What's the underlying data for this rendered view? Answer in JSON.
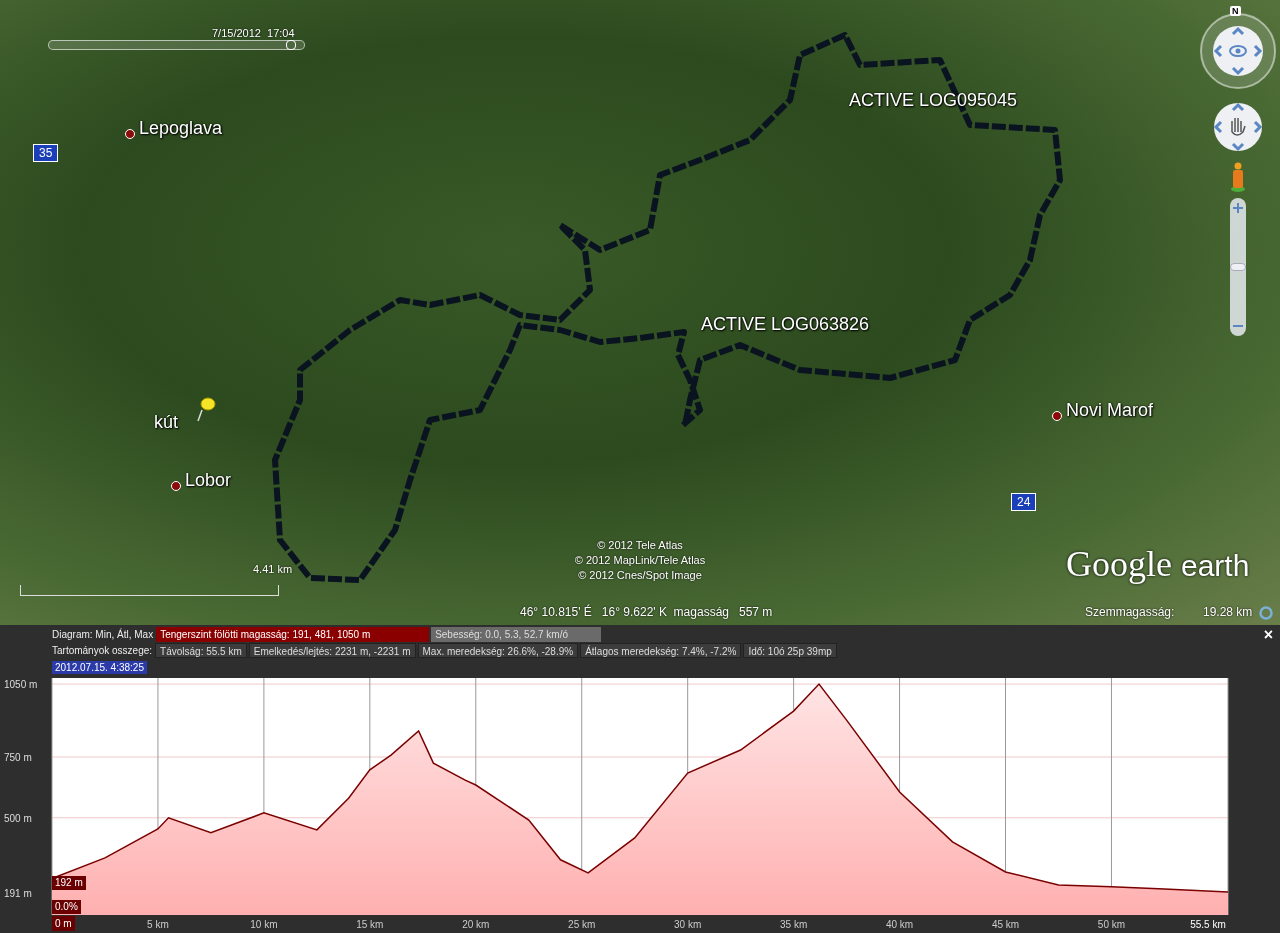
{
  "map": {
    "time_slider": {
      "label": "7/15/2012  17:04",
      "level": 0.96
    },
    "places": [
      {
        "kind": "town",
        "name": "Lepoglava"
      },
      {
        "kind": "town",
        "name": "Lobor"
      },
      {
        "kind": "town",
        "name": "Novi Marof"
      },
      {
        "kind": "pin",
        "name": "kút"
      },
      {
        "kind": "track",
        "name": "ACTIVE LOG095045"
      },
      {
        "kind": "track",
        "name": "ACTIVE LOG063826"
      },
      {
        "kind": "road",
        "name": "35"
      },
      {
        "kind": "road",
        "name": "24"
      }
    ],
    "zoom": {
      "level": 0.5
    },
    "attribution": [
      "© 2012 Tele Atlas",
      "© 2012 MapLink/Tele Atlas",
      "© 2012 Cnes/Spot Image"
    ],
    "scale": "4.41 km",
    "logo": {
      "brand": "Google",
      "product": "earth"
    },
    "status": {
      "coordinates": "46° 10.815' É   16° 9.622' K  magasság   557 m",
      "eye_label": "Szemmagasság:",
      "eye_value": "19.28 km"
    },
    "compass": "N"
  },
  "panel": {
    "diagram": {
      "label": "Diagram: Min, Átl, Max",
      "items": [
        {
          "text": "Tengerszint fölötti magasság: 191, 481, 1050 m",
          "selected": true
        },
        {
          "text": "Sebesség: 0.0, 5.3, 52.7 km/ó",
          "selected": false
        }
      ]
    },
    "totals": {
      "label": "Tartományok osszege:",
      "items": [
        "Távolság: 55.5 km",
        "Emelkedés/lejtés: 2231 m, -2231 m",
        "Max. meredekség: 26.6%, -28.9%",
        "Átlagos meredekség: 7.4%, -7.2%",
        "Idő: 10ó 25p 39mp"
      ]
    },
    "cursor_time": "2012.07.15. 4:38:25",
    "close": "×",
    "markers": {
      "elevation": "192 m",
      "slope": "0.0%"
    },
    "chart_data": {
      "type": "area",
      "x": [
        0,
        2.5,
        5,
        5.5,
        7.5,
        10,
        12.5,
        14,
        15,
        16,
        17.3,
        18,
        19.5,
        20,
        22.5,
        24,
        25.3,
        27.5,
        30,
        32.5,
        35,
        36.2,
        37.5,
        40,
        42.5,
        45,
        47.5,
        50,
        52.5,
        55.5
      ],
      "grid": true,
      "series": [
        {
          "color": "#7a0000",
          "values": [
            250,
            335,
            454,
            500,
            438,
            520,
            450,
            580,
            697,
            758,
            857,
            725,
            655,
            635,
            491,
            327,
            273,
            417,
            684,
            779,
            939,
            1050,
            902,
            606,
            401,
            277,
            224,
            216,
            207,
            195
          ]
        }
      ],
      "xlim": [
        0,
        55.5
      ],
      "ylim": [
        100,
        1075
      ],
      "xticks": [
        {
          "value": 0,
          "label": "0 m"
        },
        {
          "value": 5,
          "label": "5 km"
        },
        {
          "value": 10,
          "label": "10 km"
        },
        {
          "value": 15,
          "label": "15 km"
        },
        {
          "value": 20,
          "label": "20 km"
        },
        {
          "value": 25,
          "label": "25 km"
        },
        {
          "value": 30,
          "label": "30 km"
        },
        {
          "value": 35,
          "label": "35 km"
        },
        {
          "value": 40,
          "label": "40 km"
        },
        {
          "value": 45,
          "label": "45 km"
        },
        {
          "value": 50,
          "label": "50 km"
        },
        {
          "value": 55.5,
          "label": "55.5 km"
        }
      ],
      "yticks": [
        {
          "value": 191,
          "label": "191 m"
        },
        {
          "value": 500,
          "label": "500 m"
        },
        {
          "value": 750,
          "label": "750 m"
        },
        {
          "value": 1050,
          "label": "1050 m"
        }
      ]
    }
  }
}
